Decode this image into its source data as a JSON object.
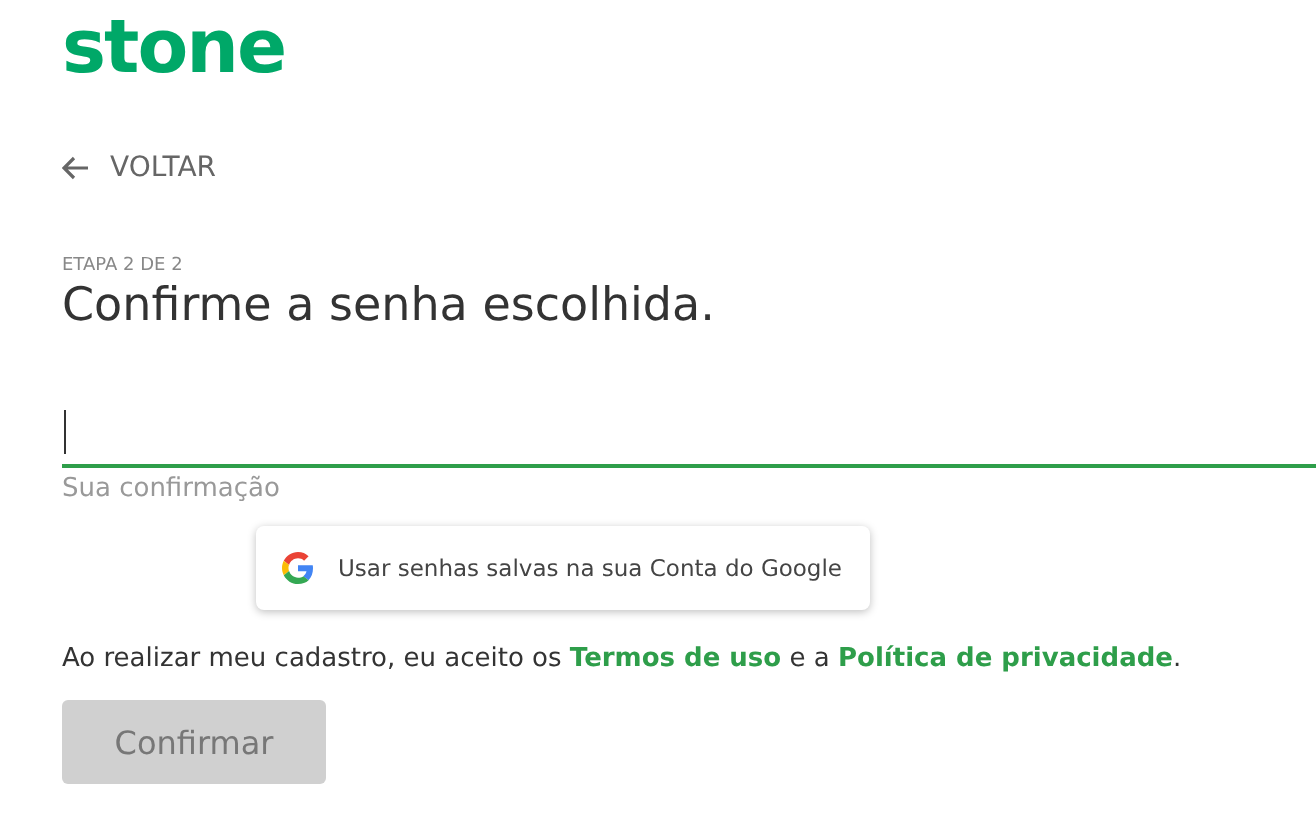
{
  "logo": "stone",
  "back_link": {
    "label": "VOLTAR"
  },
  "step": "ETAPA 2 DE 2",
  "title": "Confirme a senha escolhida.",
  "password_field": {
    "focused": true,
    "helper": "Sua confirmação"
  },
  "autofill_popup": {
    "text": "Usar senhas salvas na sua Conta do Google"
  },
  "terms": [
    {
      "kind": "text",
      "text": "Ao realizar meu cadastro, eu aceito os "
    },
    {
      "kind": "link",
      "text": "Termos de uso"
    },
    {
      "kind": "text",
      "text": " e a "
    },
    {
      "kind": "link",
      "text": "Política de privacidade"
    },
    {
      "kind": "text",
      "text": "."
    }
  ],
  "confirm_button": {
    "label": "Confirmar",
    "disabled": true
  }
}
